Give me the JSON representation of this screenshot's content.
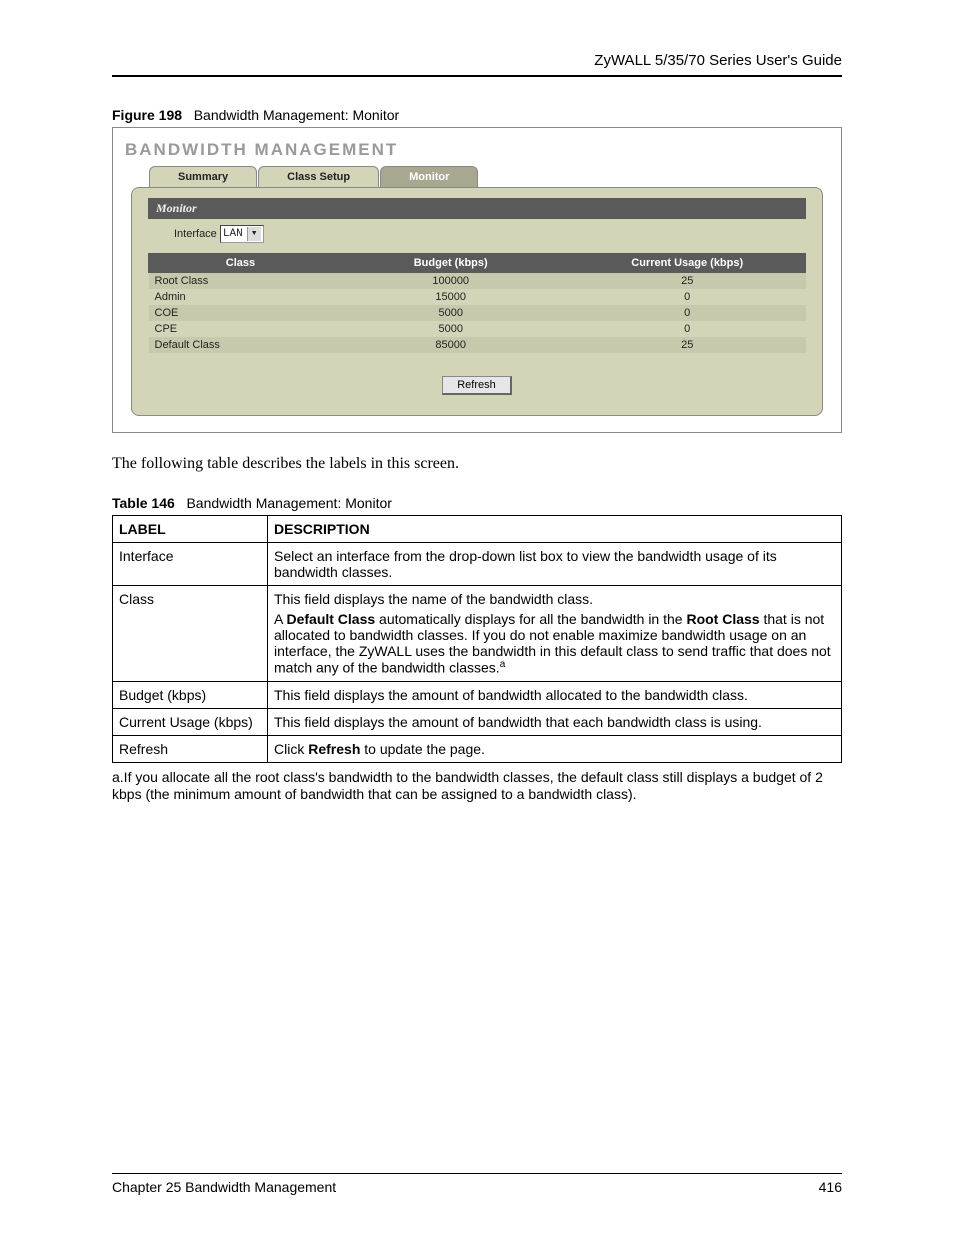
{
  "header": {
    "guide_title": "ZyWALL 5/35/70 Series User's Guide"
  },
  "figure": {
    "number": "Figure 198",
    "title": "Bandwidth Management: Monitor"
  },
  "screenshot": {
    "page_title": "BANDWIDTH MANAGEMENT",
    "tabs": {
      "summary": "Summary",
      "class_setup": "Class Setup",
      "monitor": "Monitor"
    },
    "subheader": "Monitor",
    "interface_label": "Interface",
    "interface_value": "LAN",
    "columns": {
      "class": "Class",
      "budget": "Budget (kbps)",
      "usage": "Current Usage (kbps)"
    },
    "refresh_label": "Refresh"
  },
  "chart_data": {
    "type": "table",
    "title": "Bandwidth Management: Monitor",
    "columns": [
      "Class",
      "Budget (kbps)",
      "Current Usage (kbps)"
    ],
    "rows": [
      {
        "class": "Root Class",
        "budget": 100000,
        "usage": 25
      },
      {
        "class": "Admin",
        "budget": 15000,
        "usage": 0
      },
      {
        "class": "COE",
        "budget": 5000,
        "usage": 0
      },
      {
        "class": "CPE",
        "budget": 5000,
        "usage": 0
      },
      {
        "class": "Default Class",
        "budget": 85000,
        "usage": 25
      }
    ]
  },
  "intro_para": "The following table describes the labels in this screen.",
  "table": {
    "number": "Table 146",
    "title": "Bandwidth Management: Monitor",
    "head": {
      "label": "LABEL",
      "desc": "DESCRIPTION"
    },
    "rows": {
      "interface": {
        "label": "Interface",
        "desc": "Select an interface from the drop-down list box to view the bandwidth usage of its bandwidth classes."
      },
      "class": {
        "label": "Class",
        "p1": "This field displays the name of the bandwidth class.",
        "p2a": "A ",
        "p2b": "Default Class",
        "p2c": " automatically displays for all the bandwidth in the ",
        "p2d": "Root Class",
        "p2e": " that is not allocated to bandwidth classes. If  you do not enable maximize bandwidth usage on an interface, the ZyWALL uses the bandwidth in this default class to send traffic that does not match any of the bandwidth classes.",
        "sup": "a"
      },
      "budget": {
        "label": "Budget (kbps)",
        "desc": "This field displays the amount of bandwidth allocated to the bandwidth class."
      },
      "usage": {
        "label": "Current Usage (kbps)",
        "desc": "This field displays the amount of bandwidth that each bandwidth class is using."
      },
      "refresh": {
        "label": "Refresh",
        "pre": "Click ",
        "bold": "Refresh",
        "post": " to update the page."
      }
    }
  },
  "footnote": "a.If you allocate all the root class's bandwidth to the bandwidth classes, the default class still displays a budget of 2 kbps (the minimum amount of bandwidth that can be assigned to a bandwidth class).",
  "footer": {
    "chapter": "Chapter 25 Bandwidth Management",
    "page": "416"
  }
}
